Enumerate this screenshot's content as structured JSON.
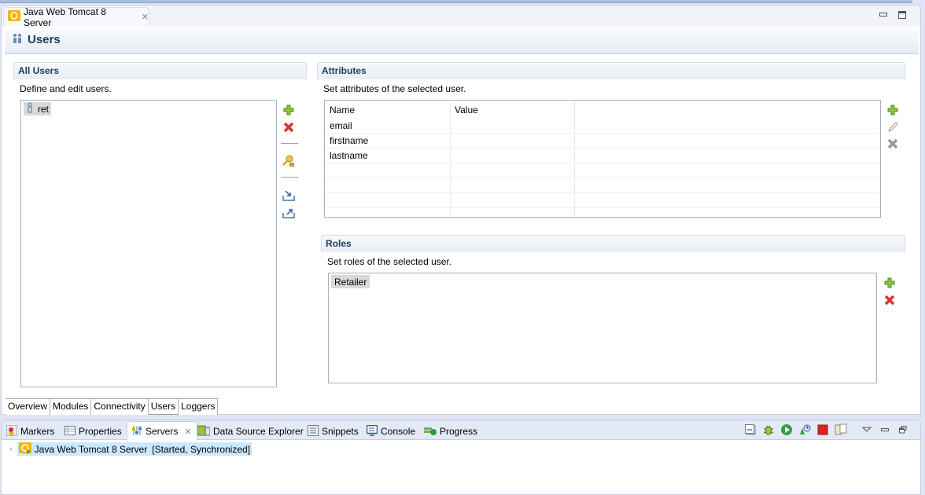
{
  "editor": {
    "tab_title": "Java Web Tomcat 8 Server",
    "form_title": "Users"
  },
  "all_users": {
    "title": "All Users",
    "description": "Define and edit users.",
    "users": [
      "ret"
    ],
    "buttons": [
      "add",
      "remove",
      "change-password",
      "import",
      "export"
    ]
  },
  "attributes": {
    "title": "Attributes",
    "description": "Set attributes of the selected user.",
    "columns": [
      "Name",
      "Value"
    ],
    "rows": [
      {
        "name": "email",
        "value": ""
      },
      {
        "name": "firstname",
        "value": ""
      },
      {
        "name": "lastname",
        "value": ""
      }
    ],
    "buttons": [
      "add",
      "edit",
      "remove"
    ]
  },
  "roles": {
    "title": "Roles",
    "description": "Set roles of the selected user.",
    "items": [
      "Retailer"
    ],
    "buttons": [
      "add",
      "remove"
    ]
  },
  "page_tabs": [
    {
      "label": "Overview",
      "active": false
    },
    {
      "label": "Modules",
      "active": false
    },
    {
      "label": "Connectivity",
      "active": false
    },
    {
      "label": "Users",
      "active": true
    },
    {
      "label": "Loggers",
      "active": false
    }
  ],
  "bottom_view": {
    "tabs": [
      {
        "label": "Markers",
        "icon": "markers-icon"
      },
      {
        "label": "Properties",
        "icon": "properties-icon"
      },
      {
        "label": "Servers",
        "icon": "servers-icon",
        "active": true
      },
      {
        "label": "Data Source Explorer",
        "icon": "data-source-icon"
      },
      {
        "label": "Snippets",
        "icon": "snippets-icon"
      },
      {
        "label": "Console",
        "icon": "console-icon"
      },
      {
        "label": "Progress",
        "icon": "progress-icon"
      }
    ],
    "server": {
      "name": "Java Web Tomcat 8 Server",
      "status": "[Started, Synchronized]"
    },
    "colors": {
      "selection": "#cce8ff",
      "stop": "#e02020",
      "start": "#2ea043"
    }
  }
}
